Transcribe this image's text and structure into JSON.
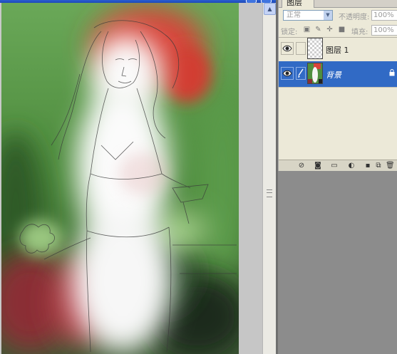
{
  "layers_panel": {
    "tab_label": "图层",
    "blend_mode": "正常",
    "opacity_label": "不透明度:",
    "opacity_value": "100%",
    "lock_label": "锁定:",
    "fill_label": "填充:",
    "fill_value": "100%",
    "layers": [
      {
        "name": "图层 1",
        "visible": true,
        "selected": false,
        "thumb": "transparent"
      },
      {
        "name": "背景",
        "visible": true,
        "selected": true,
        "locked": true,
        "thumb": "artwork"
      }
    ],
    "bottom_buttons": [
      "link-layers-icon",
      "add-style-icon",
      "add-mask-icon",
      "new-group-icon",
      "adjustment-layer-icon",
      "new-layer-icon",
      "delete-layer-icon"
    ]
  },
  "colors": {
    "selection": "#316ac5",
    "panel_bg": "#ece9d8",
    "workspace": "#8c8c8c",
    "paint_red": "#d8443a",
    "paint_green": "#5d9a4a"
  }
}
